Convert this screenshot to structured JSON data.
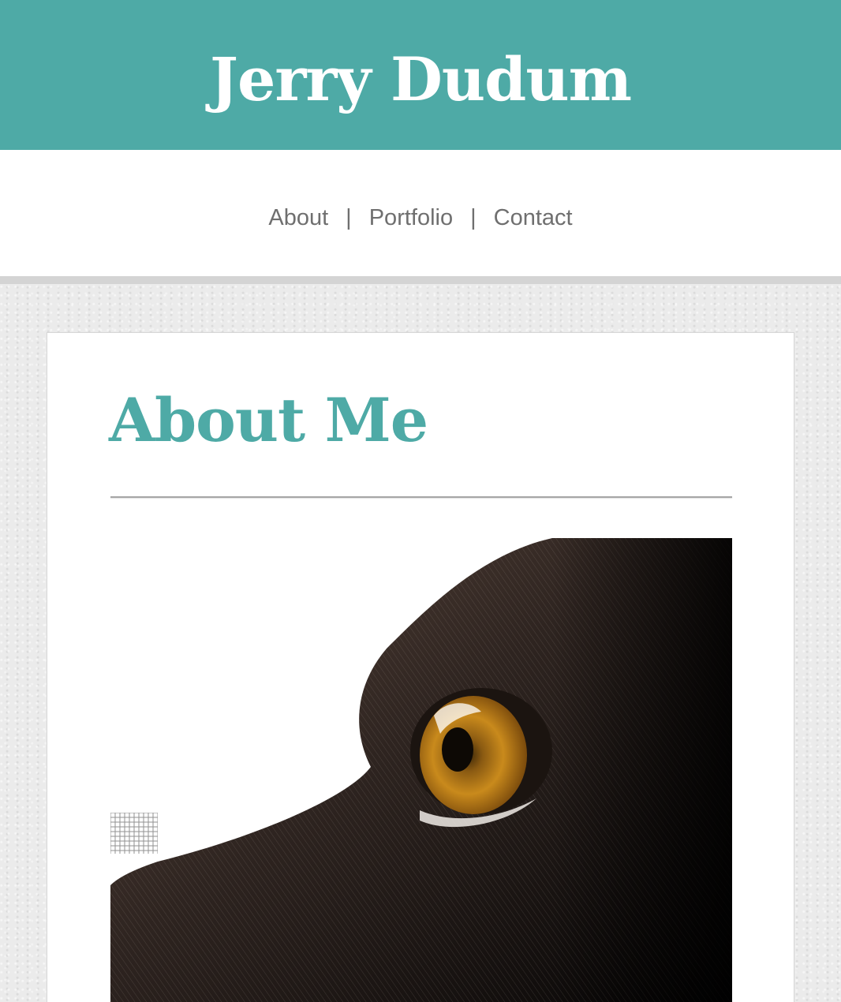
{
  "header": {
    "site_title": "Jerry Dudum",
    "background_color": "#4eaaa6"
  },
  "nav": {
    "items": [
      {
        "label": "About"
      },
      {
        "label": "Portfolio"
      },
      {
        "label": "Contact"
      }
    ],
    "separator": "|"
  },
  "main": {
    "page_title": "About Me",
    "accent_color": "#4eaaa6",
    "photo": {
      "subject": "close-up of a dark brown dog's amber eye"
    }
  }
}
